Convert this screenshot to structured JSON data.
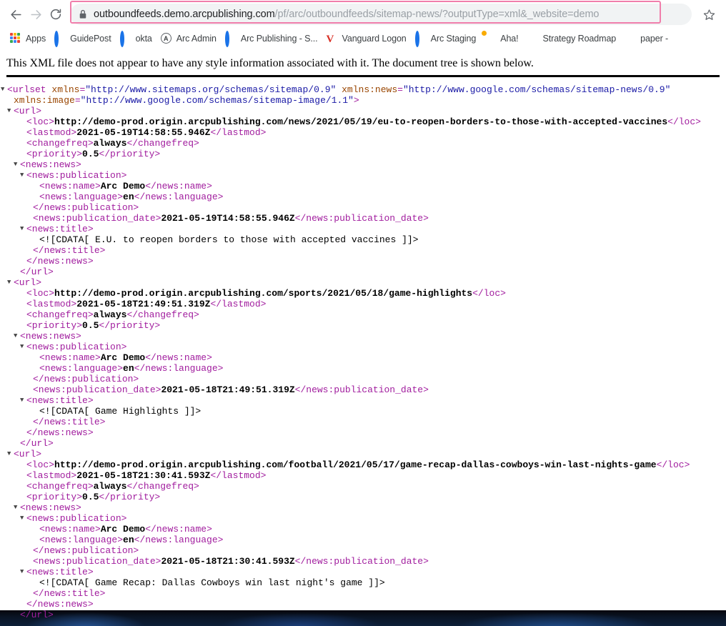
{
  "browser": {
    "back_icon": "arrow-left-icon",
    "forward_icon": "arrow-right-icon",
    "reload_icon": "reload-icon",
    "lock_icon": "lock-icon",
    "star_icon": "bookmark-star-icon",
    "url_host": "outboundfeeds.demo.arcpublishing.com",
    "url_path": "/pf/arc/outboundfeeds/sitemap-news/?outputType=xml&_website=demo",
    "url_full": "outboundfeeds.demo.arcpublishing.com/pf/arc/outboundfeeds/sitemap-news/?outputType=xml&_website=demo",
    "highlight_color": "#f07eab"
  },
  "bookmarks": [
    {
      "label": "Apps",
      "icon": "apps-grid-icon"
    },
    {
      "label": "GuidePost",
      "icon": "okta-ring-icon"
    },
    {
      "label": "okta",
      "icon": "okta-ring-icon"
    },
    {
      "label": "Arc Admin",
      "icon": "arc-admin-circle-icon"
    },
    {
      "label": "Arc Publishing - S...",
      "icon": "okta-ring-icon"
    },
    {
      "label": "Vanguard Logon",
      "icon": "vanguard-v-icon"
    },
    {
      "label": "Arc Staging",
      "icon": "okta-ring-icon"
    },
    {
      "label": "Aha!",
      "icon": "aha-icon"
    },
    {
      "label": "Strategy Roadmap",
      "icon": "bar-icon"
    },
    {
      "label": "paper -",
      "icon": "diamond-icon"
    }
  ],
  "page": {
    "notice": "This XML file does not appear to have any style information associated with it. The document tree is shown below."
  },
  "xml": {
    "colors": {
      "tag": "#a11d9e",
      "attribute": "#994500",
      "value": "#1a1aa6",
      "text": "#000000"
    },
    "lines": [
      {
        "indent": 0,
        "tw": "down",
        "parts": [
          {
            "c": "tag",
            "t": "<urlset "
          },
          {
            "c": "attr",
            "t": "xmlns"
          },
          {
            "c": "tag",
            "t": "="
          },
          {
            "c": "val",
            "t": "\"http://www.sitemaps.org/schemas/sitemap/0.9\""
          },
          {
            "c": "tag",
            "t": " "
          },
          {
            "c": "attr",
            "t": "xmlns:news"
          },
          {
            "c": "tag",
            "t": "="
          },
          {
            "c": "val",
            "t": "\"http://www.google.com/schemas/sitemap-news/0.9\""
          }
        ]
      },
      {
        "indent": 1,
        "tw": "none",
        "parts": [
          {
            "c": "attr",
            "t": "xmlns:image"
          },
          {
            "c": "tag",
            "t": "="
          },
          {
            "c": "val",
            "t": "\"http://www.google.com/schemas/sitemap-image/1.1\""
          },
          {
            "c": "tag",
            "t": ">"
          }
        ]
      },
      {
        "indent": 1,
        "tw": "down",
        "parts": [
          {
            "c": "tag",
            "t": "<url>"
          }
        ]
      },
      {
        "indent": 3,
        "tw": "none",
        "parts": [
          {
            "c": "tag",
            "t": "<loc>"
          },
          {
            "c": "txt",
            "t": "http://demo-prod.origin.arcpublishing.com/news/2021/05/19/eu-to-reopen-borders-to-those-with-accepted-vaccines"
          },
          {
            "c": "tag",
            "t": "</loc>"
          }
        ]
      },
      {
        "indent": 3,
        "tw": "none",
        "parts": [
          {
            "c": "tag",
            "t": "<lastmod>"
          },
          {
            "c": "txt",
            "t": "2021-05-19T14:58:55.946Z"
          },
          {
            "c": "tag",
            "t": "</lastmod>"
          }
        ]
      },
      {
        "indent": 3,
        "tw": "none",
        "parts": [
          {
            "c": "tag",
            "t": "<changefreq>"
          },
          {
            "c": "txt",
            "t": "always"
          },
          {
            "c": "tag",
            "t": "</changefreq>"
          }
        ]
      },
      {
        "indent": 3,
        "tw": "none",
        "parts": [
          {
            "c": "tag",
            "t": "<priority>"
          },
          {
            "c": "txt",
            "t": "0.5"
          },
          {
            "c": "tag",
            "t": "</priority>"
          }
        ]
      },
      {
        "indent": 2,
        "tw": "down",
        "parts": [
          {
            "c": "tag",
            "t": "<news:news>"
          }
        ]
      },
      {
        "indent": 3,
        "tw": "down",
        "parts": [
          {
            "c": "tag",
            "t": "<news:publication>"
          }
        ]
      },
      {
        "indent": 5,
        "tw": "none",
        "parts": [
          {
            "c": "tag",
            "t": "<news:name>"
          },
          {
            "c": "txt",
            "t": "Arc Demo"
          },
          {
            "c": "tag",
            "t": "</news:name>"
          }
        ]
      },
      {
        "indent": 5,
        "tw": "none",
        "parts": [
          {
            "c": "tag",
            "t": "<news:language>"
          },
          {
            "c": "txt",
            "t": "en"
          },
          {
            "c": "tag",
            "t": "</news:language>"
          }
        ]
      },
      {
        "indent": 4,
        "tw": "none",
        "parts": [
          {
            "c": "tag",
            "t": "</news:publication>"
          }
        ]
      },
      {
        "indent": 4,
        "tw": "none",
        "parts": [
          {
            "c": "tag",
            "t": "<news:publication_date>"
          },
          {
            "c": "txt",
            "t": "2021-05-19T14:58:55.946Z"
          },
          {
            "c": "tag",
            "t": "</news:publication_date>"
          }
        ]
      },
      {
        "indent": 3,
        "tw": "down",
        "parts": [
          {
            "c": "tag",
            "t": "<news:title>"
          }
        ]
      },
      {
        "indent": 5,
        "tw": "none",
        "parts": [
          {
            "c": "cdata",
            "t": "<![CDATA[ E.U. to reopen borders to those with accepted vaccines ]]>"
          }
        ]
      },
      {
        "indent": 4,
        "tw": "none",
        "parts": [
          {
            "c": "tag",
            "t": "</news:title>"
          }
        ]
      },
      {
        "indent": 3,
        "tw": "none",
        "parts": [
          {
            "c": "tag",
            "t": "</news:news>"
          }
        ]
      },
      {
        "indent": 2,
        "tw": "none",
        "parts": [
          {
            "c": "tag",
            "t": "</url>"
          }
        ]
      },
      {
        "indent": 1,
        "tw": "down",
        "parts": [
          {
            "c": "tag",
            "t": "<url>"
          }
        ]
      },
      {
        "indent": 3,
        "tw": "none",
        "parts": [
          {
            "c": "tag",
            "t": "<loc>"
          },
          {
            "c": "txt",
            "t": "http://demo-prod.origin.arcpublishing.com/sports/2021/05/18/game-highlights"
          },
          {
            "c": "tag",
            "t": "</loc>"
          }
        ]
      },
      {
        "indent": 3,
        "tw": "none",
        "parts": [
          {
            "c": "tag",
            "t": "<lastmod>"
          },
          {
            "c": "txt",
            "t": "2021-05-18T21:49:51.319Z"
          },
          {
            "c": "tag",
            "t": "</lastmod>"
          }
        ]
      },
      {
        "indent": 3,
        "tw": "none",
        "parts": [
          {
            "c": "tag",
            "t": "<changefreq>"
          },
          {
            "c": "txt",
            "t": "always"
          },
          {
            "c": "tag",
            "t": "</changefreq>"
          }
        ]
      },
      {
        "indent": 3,
        "tw": "none",
        "parts": [
          {
            "c": "tag",
            "t": "<priority>"
          },
          {
            "c": "txt",
            "t": "0.5"
          },
          {
            "c": "tag",
            "t": "</priority>"
          }
        ]
      },
      {
        "indent": 2,
        "tw": "down",
        "parts": [
          {
            "c": "tag",
            "t": "<news:news>"
          }
        ]
      },
      {
        "indent": 3,
        "tw": "down",
        "parts": [
          {
            "c": "tag",
            "t": "<news:publication>"
          }
        ]
      },
      {
        "indent": 5,
        "tw": "none",
        "parts": [
          {
            "c": "tag",
            "t": "<news:name>"
          },
          {
            "c": "txt",
            "t": "Arc Demo"
          },
          {
            "c": "tag",
            "t": "</news:name>"
          }
        ]
      },
      {
        "indent": 5,
        "tw": "none",
        "parts": [
          {
            "c": "tag",
            "t": "<news:language>"
          },
          {
            "c": "txt",
            "t": "en"
          },
          {
            "c": "tag",
            "t": "</news:language>"
          }
        ]
      },
      {
        "indent": 4,
        "tw": "none",
        "parts": [
          {
            "c": "tag",
            "t": "</news:publication>"
          }
        ]
      },
      {
        "indent": 4,
        "tw": "none",
        "parts": [
          {
            "c": "tag",
            "t": "<news:publication_date>"
          },
          {
            "c": "txt",
            "t": "2021-05-18T21:49:51.319Z"
          },
          {
            "c": "tag",
            "t": "</news:publication_date>"
          }
        ]
      },
      {
        "indent": 3,
        "tw": "down",
        "parts": [
          {
            "c": "tag",
            "t": "<news:title>"
          }
        ]
      },
      {
        "indent": 5,
        "tw": "none",
        "parts": [
          {
            "c": "cdata",
            "t": "<![CDATA[ Game Highlights ]]>"
          }
        ]
      },
      {
        "indent": 4,
        "tw": "none",
        "parts": [
          {
            "c": "tag",
            "t": "</news:title>"
          }
        ]
      },
      {
        "indent": 3,
        "tw": "none",
        "parts": [
          {
            "c": "tag",
            "t": "</news:news>"
          }
        ]
      },
      {
        "indent": 2,
        "tw": "none",
        "parts": [
          {
            "c": "tag",
            "t": "</url>"
          }
        ]
      },
      {
        "indent": 1,
        "tw": "down",
        "parts": [
          {
            "c": "tag",
            "t": "<url>"
          }
        ]
      },
      {
        "indent": 3,
        "tw": "none",
        "parts": [
          {
            "c": "tag",
            "t": "<loc>"
          },
          {
            "c": "txt",
            "t": "http://demo-prod.origin.arcpublishing.com/football/2021/05/17/game-recap-dallas-cowboys-win-last-nights-game"
          },
          {
            "c": "tag",
            "t": "</loc>"
          }
        ]
      },
      {
        "indent": 3,
        "tw": "none",
        "parts": [
          {
            "c": "tag",
            "t": "<lastmod>"
          },
          {
            "c": "txt",
            "t": "2021-05-18T21:30:41.593Z"
          },
          {
            "c": "tag",
            "t": "</lastmod>"
          }
        ]
      },
      {
        "indent": 3,
        "tw": "none",
        "parts": [
          {
            "c": "tag",
            "t": "<changefreq>"
          },
          {
            "c": "txt",
            "t": "always"
          },
          {
            "c": "tag",
            "t": "</changefreq>"
          }
        ]
      },
      {
        "indent": 3,
        "tw": "none",
        "parts": [
          {
            "c": "tag",
            "t": "<priority>"
          },
          {
            "c": "txt",
            "t": "0.5"
          },
          {
            "c": "tag",
            "t": "</priority>"
          }
        ]
      },
      {
        "indent": 2,
        "tw": "down",
        "parts": [
          {
            "c": "tag",
            "t": "<news:news>"
          }
        ]
      },
      {
        "indent": 3,
        "tw": "down",
        "parts": [
          {
            "c": "tag",
            "t": "<news:publication>"
          }
        ]
      },
      {
        "indent": 5,
        "tw": "none",
        "parts": [
          {
            "c": "tag",
            "t": "<news:name>"
          },
          {
            "c": "txt",
            "t": "Arc Demo"
          },
          {
            "c": "tag",
            "t": "</news:name>"
          }
        ]
      },
      {
        "indent": 5,
        "tw": "none",
        "parts": [
          {
            "c": "tag",
            "t": "<news:language>"
          },
          {
            "c": "txt",
            "t": "en"
          },
          {
            "c": "tag",
            "t": "</news:language>"
          }
        ]
      },
      {
        "indent": 4,
        "tw": "none",
        "parts": [
          {
            "c": "tag",
            "t": "</news:publication>"
          }
        ]
      },
      {
        "indent": 4,
        "tw": "none",
        "parts": [
          {
            "c": "tag",
            "t": "<news:publication_date>"
          },
          {
            "c": "txt",
            "t": "2021-05-18T21:30:41.593Z"
          },
          {
            "c": "tag",
            "t": "</news:publication_date>"
          }
        ]
      },
      {
        "indent": 3,
        "tw": "down",
        "parts": [
          {
            "c": "tag",
            "t": "<news:title>"
          }
        ]
      },
      {
        "indent": 5,
        "tw": "none",
        "parts": [
          {
            "c": "cdata",
            "t": "<![CDATA[ Game Recap: Dallas Cowboys win last night's game ]]>"
          }
        ]
      },
      {
        "indent": 4,
        "tw": "none",
        "parts": [
          {
            "c": "tag",
            "t": "</news:title>"
          }
        ]
      },
      {
        "indent": 3,
        "tw": "none",
        "parts": [
          {
            "c": "tag",
            "t": "</news:news>"
          }
        ]
      },
      {
        "indent": 2,
        "tw": "none",
        "parts": [
          {
            "c": "tag",
            "t": "</url>"
          }
        ]
      }
    ]
  }
}
